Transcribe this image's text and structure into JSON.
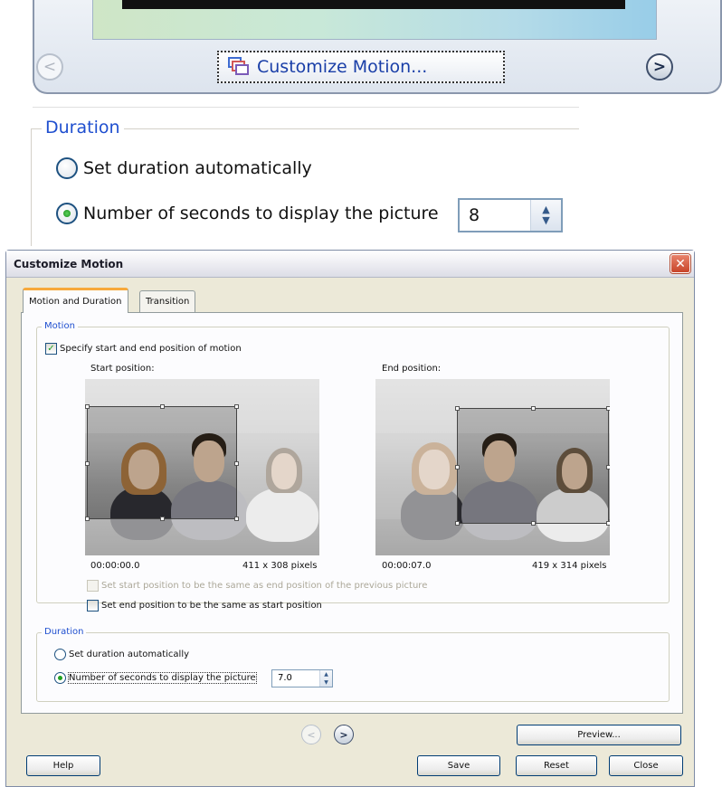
{
  "top_panel": {
    "customize_button_label": "Customize Motion...",
    "nav_left": "<",
    "nav_right": ">"
  },
  "zoom_duration": {
    "legend": "Duration",
    "auto_label": "Set duration automatically",
    "seconds_label": "Number of seconds to display the picture",
    "seconds_value": "8"
  },
  "dialog": {
    "title": "Customize Motion",
    "close_glyph": "✕",
    "tabs": [
      {
        "label": "Motion and Duration",
        "active": true
      },
      {
        "label": "Transition",
        "active": false
      }
    ],
    "motion": {
      "legend": "Motion",
      "specify_label": "Specify start and end position of motion",
      "specify_checked": true,
      "start_label": "Start position:",
      "end_label": "End position:",
      "start_time": "00:00:00.0",
      "start_size": "411 x 308 pixels",
      "end_time": "00:00:07.0",
      "end_size": "419 x 314 pixels",
      "same_as_prev_label": "Set start position to be the same as end position of the previous picture",
      "same_as_start_label": "Set end position to be the same as start position"
    },
    "duration": {
      "legend": "Duration",
      "auto_label": "Set duration automatically",
      "seconds_label": "Number of seconds to display the picture",
      "seconds_value": "7.0"
    },
    "buttons": {
      "preview": "Preview...",
      "help": "Help",
      "save": "Save",
      "reset": "Reset",
      "close": "Close"
    },
    "icons": {
      "checkmark": "✓",
      "spin_up": "▲",
      "spin_down": "▼"
    },
    "colors": {
      "accent_blue": "#1f4fcf",
      "tab_highlight": "#f7a93b",
      "close_red": "#c8452a"
    }
  }
}
